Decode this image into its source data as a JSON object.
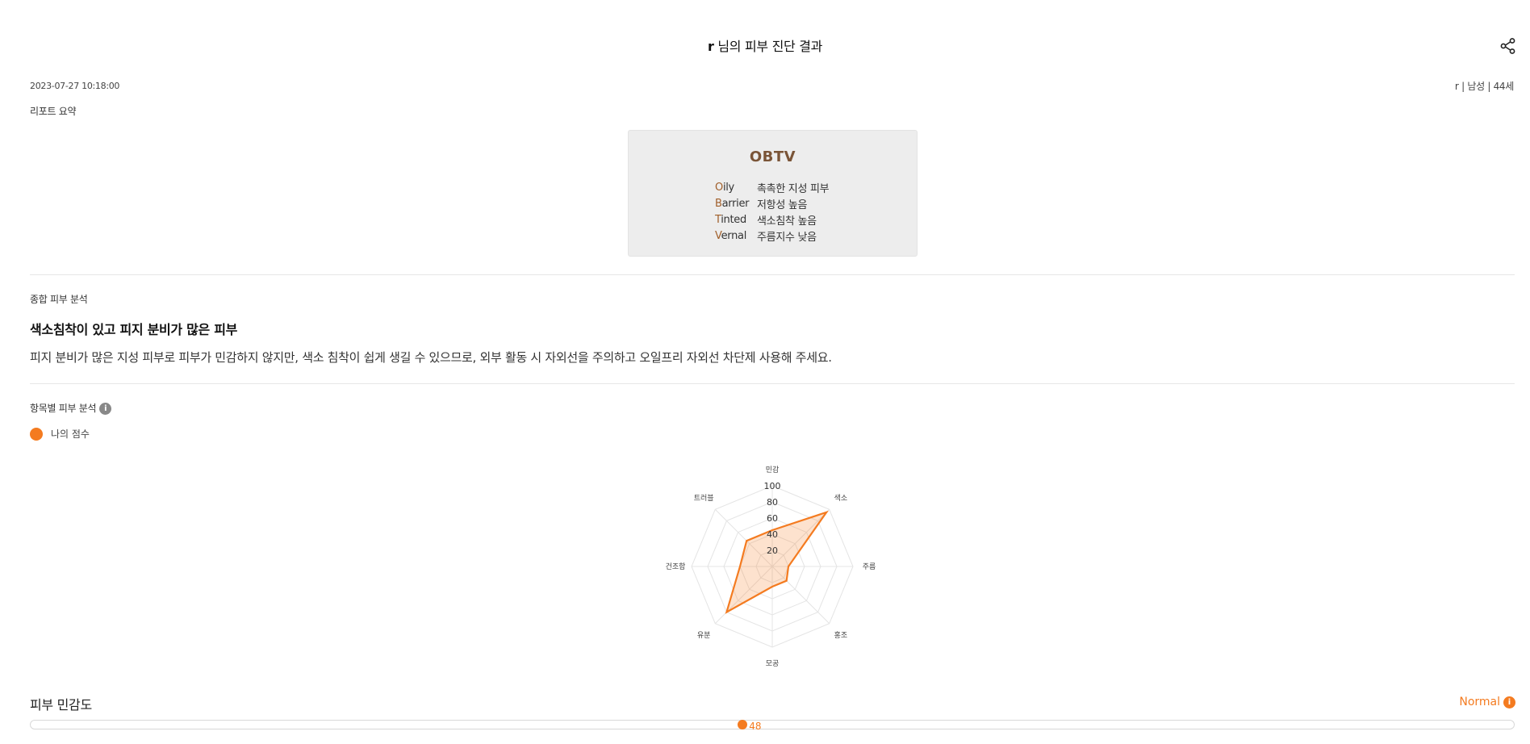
{
  "header": {
    "user": "r",
    "title_suffix": "님의 피부 진단 결과",
    "share_icon": "share-icon"
  },
  "meta": {
    "datetime": "2023-07-27 10:18:00",
    "user_info": "r | 남성 | 44세"
  },
  "summary": {
    "label": "리포트 요약",
    "type_code": "OBTV",
    "rows": [
      {
        "initial": "O",
        "rest": "ily",
        "desc": "촉촉한 지성 피부"
      },
      {
        "initial": "B",
        "rest": "arrier",
        "desc": "저항성 높음"
      },
      {
        "initial": "T",
        "rest": "inted",
        "desc": "색소침착 높음"
      },
      {
        "initial": "V",
        "rest": "ernal",
        "desc": "주름지수 낮음"
      }
    ]
  },
  "overall": {
    "label": "종합 피부 분석",
    "title": "색소침착이 있고 피지 분비가 많은 피부",
    "description": "피지 분비가 많은 지성 피부로 피부가 민감하지 않지만, 색소 침착이 쉽게 생길 수 있으므로, 외부 활동 시 자외선을 주의하고 오일프리 자외선 차단제 사용해 주세요."
  },
  "item_analysis": {
    "label": "항목별 피부 분석",
    "info_icon": "info-icon",
    "legend": "나의 점수"
  },
  "chart_data": {
    "type": "radar",
    "axes": [
      "민감",
      "색소",
      "주름",
      "홍조",
      "모공",
      "유분",
      "건조함",
      "트러블"
    ],
    "series": [
      {
        "name": "나의 점수",
        "values": [
          45,
          95,
          20,
          25,
          25,
          80,
          40,
          45
        ]
      }
    ],
    "rlim": [
      0,
      100
    ],
    "ticks": [
      20,
      40,
      60,
      80,
      100
    ],
    "color": "#f47b20"
  },
  "sensitivity": {
    "title": "피부 민감도",
    "status": "Normal",
    "value": 48,
    "max": 100,
    "color": "#f47b20"
  }
}
